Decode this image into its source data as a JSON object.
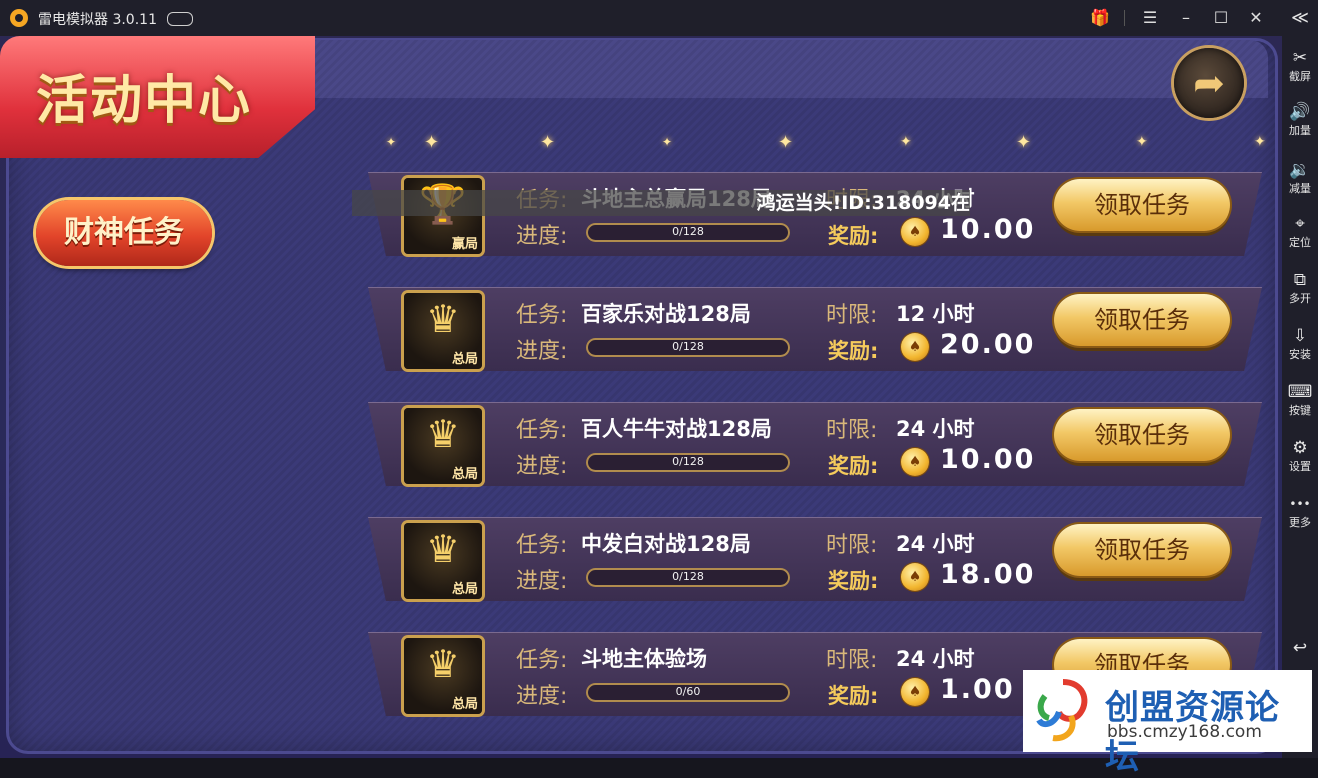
{
  "window": {
    "title": "雷电模拟器 3.0.11",
    "controls": {
      "menu": "☰",
      "minimize": "–",
      "maximize": "☐",
      "close": "✕"
    }
  },
  "sidebar": {
    "collapse": "≪",
    "items": [
      {
        "icon": "scissors-icon",
        "glyph": "✂",
        "label": "截屏"
      },
      {
        "icon": "volume-up-icon",
        "glyph": "🔊",
        "label": "加量"
      },
      {
        "icon": "volume-down-icon",
        "glyph": "🔉",
        "label": "减量"
      },
      {
        "icon": "location-pin-icon",
        "glyph": "⌖",
        "label": "定位"
      },
      {
        "icon": "multi-window-icon",
        "glyph": "⧉",
        "label": "多开"
      },
      {
        "icon": "apk-install-icon",
        "glyph": "⇩",
        "label": "安装"
      },
      {
        "icon": "keyboard-icon",
        "glyph": "⌨",
        "label": "按键"
      },
      {
        "icon": "gear-icon",
        "glyph": "⚙",
        "label": "设置"
      },
      {
        "icon": "more-icon",
        "glyph": "•••",
        "label": "更多"
      }
    ],
    "back_glyph": "↩"
  },
  "game": {
    "banner_title": "活动中心",
    "side_button": "财神任务",
    "back_glyph": "➦",
    "labels": {
      "task": "任务:",
      "progress": "进度:",
      "limit": "时限:",
      "reward": "奖励:",
      "claim": "领取任务"
    },
    "tasks": [
      {
        "name": "斗地主总赢局128局",
        "icon_tag": "赢局",
        "progress_text": "0/128",
        "progress": 0,
        "limit": "24 小时",
        "reward": "10.00"
      },
      {
        "name": "百家乐对战128局",
        "icon_tag": "总局",
        "progress_text": "0/128",
        "progress": 0,
        "limit": "12 小时",
        "reward": "20.00"
      },
      {
        "name": "百人牛牛对战128局",
        "icon_tag": "总局",
        "progress_text": "0/128",
        "progress": 0,
        "limit": "24 小时",
        "reward": "10.00"
      },
      {
        "name": "中发白对战128局",
        "icon_tag": "总局",
        "progress_text": "0/128",
        "progress": 0,
        "limit": "24 小时",
        "reward": "18.00"
      },
      {
        "name": "斗地主体验场",
        "icon_tag": "总局",
        "progress_text": "0/60",
        "progress": 0,
        "limit": "24 小时",
        "reward": "1.00"
      }
    ],
    "notice": "鸿运当头!ID:318094在"
  },
  "watermark": {
    "name": "创盟资源论坛",
    "url": "bbs.cmzy168.com"
  },
  "colors": {
    "accent_gold": "#f5cb5c",
    "banner_red": "#e0313c",
    "panel_purple": "#3b3a78",
    "watermark_blue": "#1e5fb3"
  }
}
